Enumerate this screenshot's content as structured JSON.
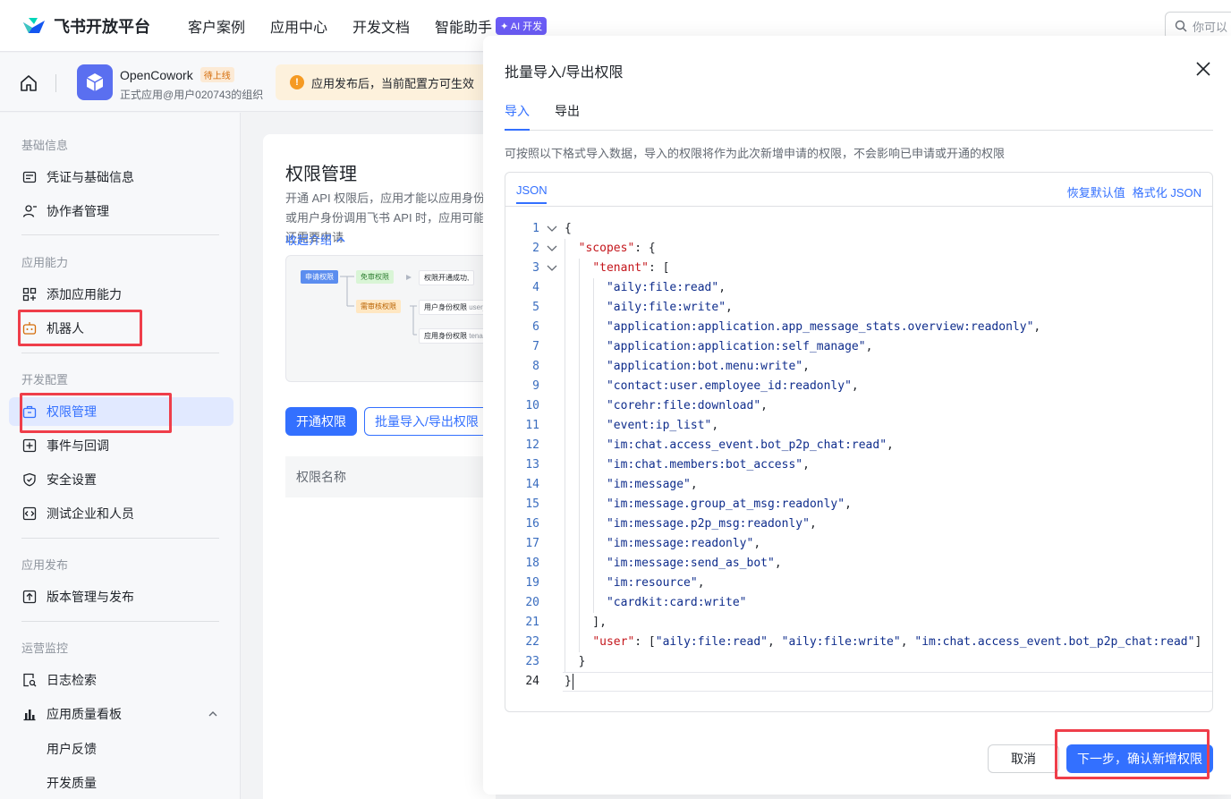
{
  "topnav": {
    "brand": "飞书开放平台",
    "items": [
      "客户案例",
      "应用中心",
      "开发文档",
      "智能助手"
    ],
    "ai_badge": "✦ AI 开发",
    "search_placeholder": "你可以"
  },
  "app": {
    "name": "OpenCowork",
    "status": "待上线",
    "subtitle": "正式应用@用户020743的组织",
    "notice": "应用发布后，当前配置方可生效"
  },
  "sidebar": {
    "sections": {
      "basic": "基础信息",
      "capability": "应用能力",
      "dev": "开发配置",
      "publish": "应用发布",
      "ops": "运营监控"
    },
    "items": {
      "credentials": "凭证与基础信息",
      "collaborators": "协作者管理",
      "add_capability": "添加应用能力",
      "bot": "机器人",
      "permissions": "权限管理",
      "events": "事件与回调",
      "security": "安全设置",
      "test_org": "测试企业和人员",
      "versions": "版本管理与发布",
      "logs": "日志检索",
      "quality": "应用质量看板",
      "feedback": "用户反馈",
      "dev_quality": "开发质量"
    }
  },
  "main": {
    "title": "权限管理",
    "desc": "开通 API 权限后，应用才能以应用身份或用户身份调用飞书 API 时，应用可能还需要申请",
    "collapse": "收起介绍",
    "flow": {
      "apply": "申请权限",
      "no_review": "免审权限",
      "success": "权限开通成功,",
      "need_review": "需审核权限",
      "user_identity": "用户身份权限",
      "user_suffix": "user_",
      "app_identity": "应用身份权限",
      "app_suffix": "tenan"
    },
    "btn_enable": "开通权限",
    "btn_batch": "批量导入/导出权限",
    "table_col": "权限名称"
  },
  "dialog": {
    "title": "批量导入/导出权限",
    "tabs": [
      "导入",
      "导出"
    ],
    "desc": "可按照以下格式导入数据，导入的权限将作为此次新增申请的权限，不会影响已申请或开通的权限",
    "editor_tab": "JSON",
    "restore": "恢复默认值",
    "format": "格式化 JSON",
    "tenant_scopes": [
      "aily:file:read",
      "aily:file:write",
      "application:application.app_message_stats.overview:readonly",
      "application:application:self_manage",
      "application:bot.menu:write",
      "contact:user.employee_id:readonly",
      "corehr:file:download",
      "event:ip_list",
      "im:chat.access_event.bot_p2p_chat:read",
      "im:chat.members:bot_access",
      "im:message",
      "im:message.group_at_msg:readonly",
      "im:message.p2p_msg:readonly",
      "im:message:readonly",
      "im:message:send_as_bot",
      "im:resource",
      "cardkit:card:write"
    ],
    "user_scopes": [
      "aily:file:read",
      "aily:file:write",
      "im:chat.access_event.bot_p2p_chat:read"
    ],
    "cancel": "取消",
    "next": "下一步，确认新增权限"
  }
}
